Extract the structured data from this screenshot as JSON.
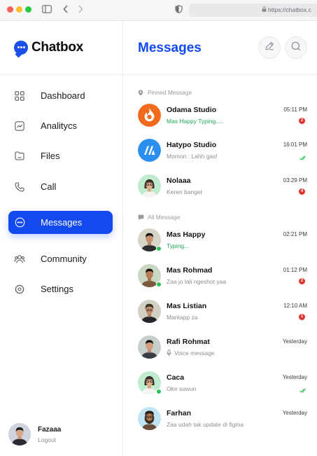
{
  "browser": {
    "url": "https://chatbox.c"
  },
  "brand": {
    "name": "Chatbox",
    "accent": "#1249f1"
  },
  "sidebar": {
    "items": [
      {
        "label": "Dashboard",
        "icon": "grid-icon",
        "active": false
      },
      {
        "label": "Analitycs",
        "icon": "chart-icon",
        "active": false
      },
      {
        "label": "Files",
        "icon": "folder-icon",
        "active": false
      },
      {
        "label": "Call",
        "icon": "phone-icon",
        "active": false
      },
      {
        "label": "Messages",
        "icon": "chat-icon",
        "active": true
      },
      {
        "label": "Community",
        "icon": "users-icon",
        "active": false
      },
      {
        "label": "Settings",
        "icon": "gear-icon",
        "active": false
      }
    ]
  },
  "profile": {
    "name": "Fazaaa",
    "action": "Logout"
  },
  "main": {
    "title": "Messages",
    "actions": [
      "edit-icon",
      "search-icon"
    ],
    "pinned_label": "Pinned Message",
    "all_label": "All Message"
  },
  "pinned": [
    {
      "name": "Odama Studio",
      "preview": "Mas Happy Typing.....",
      "time": "05:11 PM",
      "badge": "2",
      "typing": true,
      "avatar": "odama-logo"
    },
    {
      "name": "Hatypo Studio",
      "preview": "Momon : Lahh gas!",
      "time": "16:01 PM",
      "read": true,
      "avatar": "hatypo-logo"
    },
    {
      "name": "Nolaaa",
      "preview": "Keren banget",
      "time": "03:29 PM",
      "badge": "4",
      "avatar": "person"
    }
  ],
  "all": [
    {
      "name": "Mas Happy",
      "preview": "Typing...",
      "time": "02:21 PM",
      "typing": true,
      "online": true
    },
    {
      "name": "Mas Rohmad",
      "preview": "Zaa jo lali ngeshot yaa",
      "time": "01:12 PM",
      "badge": "2",
      "online": true
    },
    {
      "name": "Mas Listian",
      "preview": "Mantapp za",
      "time": "12:10 AM",
      "badge": "1"
    },
    {
      "name": "Rafi Rohmat",
      "preview": "Voice message",
      "time": "Yesterday",
      "voice": true
    },
    {
      "name": "Caca",
      "preview": "Oke suwun",
      "time": "Yesterday",
      "read": true,
      "online": true
    },
    {
      "name": "Farhan",
      "preview": "Zaa udah tak update di figma",
      "time": "Yesterday"
    }
  ]
}
